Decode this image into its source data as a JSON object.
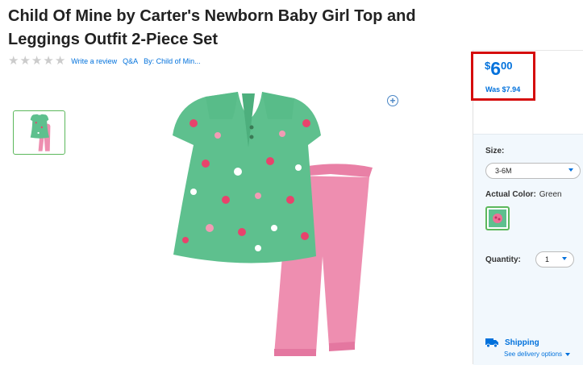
{
  "product": {
    "title": "Child Of Mine by Carter's Newborn Baby Girl Top and Leggings Outfit 2-Piece Set"
  },
  "meta": {
    "star_count": 5,
    "rating": 0,
    "write_review": "Write a review",
    "qa": "Q&A",
    "by": "By: Child of Min..."
  },
  "price": {
    "currency": "$",
    "dollars": "6",
    "cents": "00",
    "was": "Was $7.94"
  },
  "options": {
    "size_label": "Size:",
    "size_value": "3-6M",
    "color_label": "Actual Color:",
    "color_value": "Green",
    "quantity_label": "Quantity:",
    "quantity_value": "1"
  },
  "shipping": {
    "label": "Shipping",
    "delivery": "See delivery options"
  },
  "colors": {
    "link_blue": "#0071dc",
    "highlight_red": "#d50b0b",
    "top_green": "#5ec08e",
    "leggings_pink": "#ee8eb0",
    "selected_green": "#5cb85c"
  },
  "icons": {
    "zoom": "zoom-in-plus-icon",
    "star": "star-icon",
    "truck": "truck-icon"
  }
}
